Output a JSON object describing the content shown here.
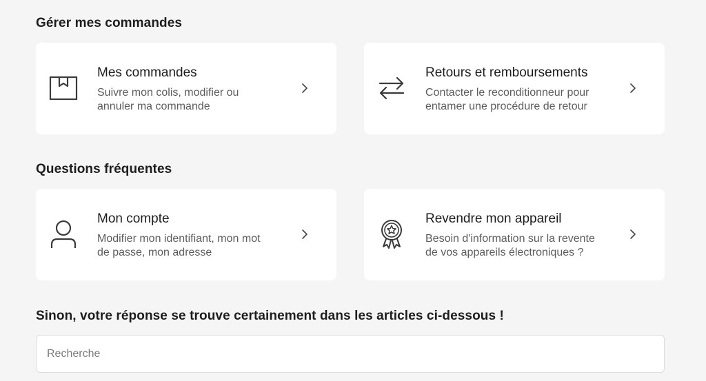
{
  "sections": {
    "manage_orders": "Gérer mes commandes",
    "faq": "Questions fréquentes",
    "articles": "Sinon, votre réponse se trouve certainement dans les articles ci-dessous !"
  },
  "cards": {
    "orders": {
      "icon": "package-icon",
      "title": "Mes commandes",
      "desc_line1": "Suivre mon colis, modifier ou",
      "desc_line2": "annuler ma commande"
    },
    "returns": {
      "icon": "arrows-exchange-icon",
      "title": "Retours et remboursements",
      "desc_line1": "Contacter le reconditionneur pour",
      "desc_line2": "entamer une procédure de retour"
    },
    "account": {
      "icon": "user-icon",
      "title": "Mon compte",
      "desc_line1": "Modifier mon identifiant, mon mot",
      "desc_line2": "de passe, mon adresse"
    },
    "resell": {
      "icon": "award-badge-icon",
      "title": "Revendre mon appareil",
      "desc_line1": "Besoin d'information sur la revente",
      "desc_line2": "de vos appareils électroniques ?"
    }
  },
  "search": {
    "placeholder": "Recherche",
    "value": ""
  },
  "colors": {
    "background": "#f5f5f5",
    "card": "#ffffff",
    "text": "#1d1d1d",
    "muted": "#5c5c5c"
  }
}
